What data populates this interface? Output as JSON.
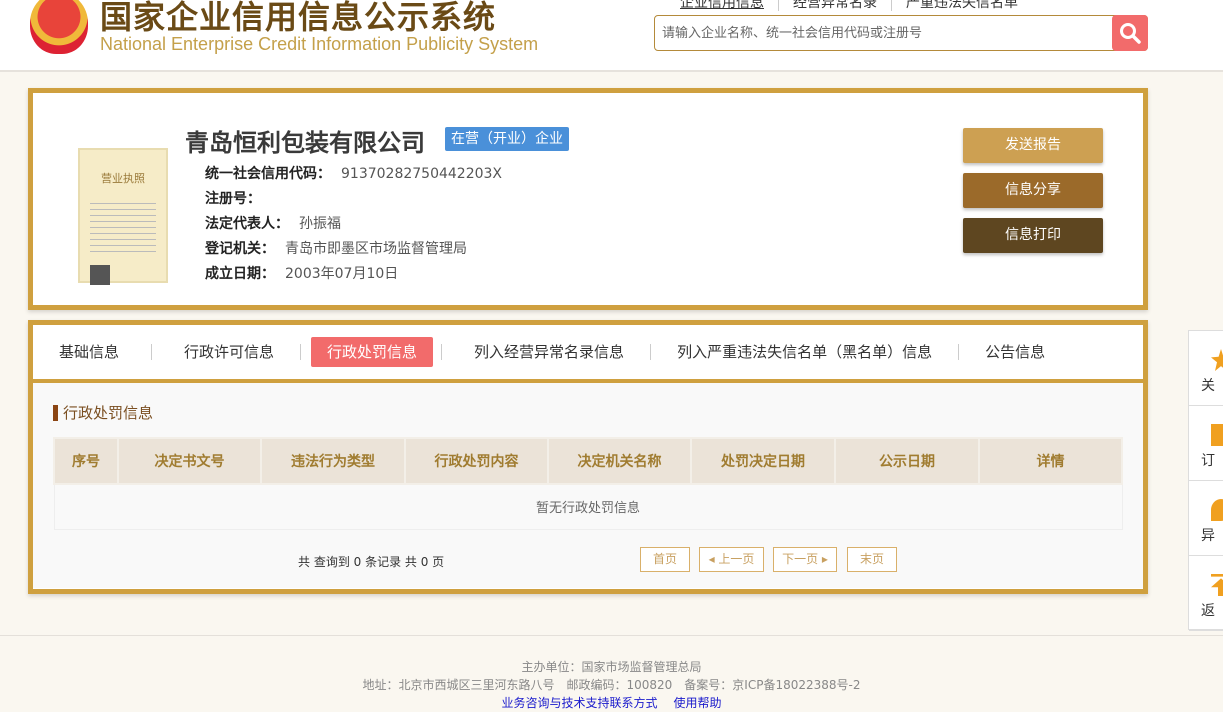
{
  "header": {
    "title_cn": "国家企业信用信息公示系统",
    "title_en": "National Enterprise Credit Information Publicity System",
    "nav": [
      "企业信用信息",
      "经营异常名录",
      "严重违法失信名单"
    ],
    "search_placeholder": "请输入企业名称、统一社会信用代码或注册号"
  },
  "company": {
    "name": "青岛恒利包装有限公司",
    "status": "在营（开业）企业",
    "fields": [
      {
        "label": "统一社会信用代码：",
        "value": "91370282750442203X"
      },
      {
        "label": "注册号：",
        "value": ""
      },
      {
        "label": "法定代表人：",
        "value": "孙振福"
      },
      {
        "label": "登记机关：",
        "value": "青岛市即墨区市场监督管理局"
      },
      {
        "label": "成立日期：",
        "value": "2003年07月10日"
      }
    ],
    "license_label": "营业执照"
  },
  "actions": {
    "send": "发送报告",
    "share": "信息分享",
    "print": "信息打印"
  },
  "tabs": [
    "基础信息",
    "行政许可信息",
    "行政处罚信息",
    "列入经营异常名录信息",
    "列入严重违法失信名单（黑名单）信息",
    "公告信息"
  ],
  "active_tab": "行政处罚信息",
  "section": {
    "title": "行政处罚信息",
    "columns": [
      "序号",
      "决定书文号",
      "违法行为类型",
      "行政处罚内容",
      "决定机关名称",
      "处罚决定日期",
      "公示日期",
      "详情"
    ],
    "empty": "暂无行政处罚信息"
  },
  "pagination": {
    "summary": "共 查询到 0 条记录 共 0 页",
    "first": "首页",
    "prev": "上一页",
    "next": "下一页",
    "last": "末页"
  },
  "side": [
    "关",
    "订",
    "异",
    "返"
  ],
  "footer": {
    "line1": "主办单位：国家市场监督管理总局",
    "line2": "地址：北京市西城区三里河东路八号　邮政编码：100820　备案号：京ICP备18022388号-2",
    "link1": "业务咨询与技术支持联系方式",
    "link2": "使用帮助"
  },
  "colors": {
    "gold": "#cfa03f",
    "active_tab": "#f26b6b",
    "badge": "#4a90d9"
  }
}
